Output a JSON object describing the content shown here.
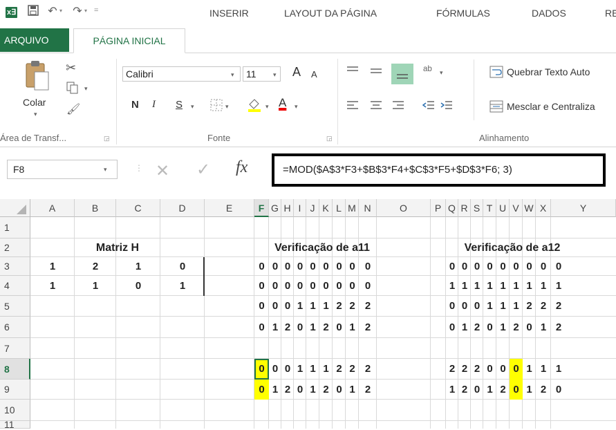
{
  "quick_access": {
    "undo_arrow": "↶",
    "redo_arrow": "↷"
  },
  "tabs": [
    "ARQUIVO",
    "PÁGINA INICIAL",
    "INSERIR",
    "LAYOUT DA PÁGINA",
    "FÓRMULAS",
    "DADOS",
    "RE"
  ],
  "ribbon": {
    "clipboard": {
      "paste": "Colar",
      "group": "Área de Transf..."
    },
    "font": {
      "name": "Calibri",
      "size": "11",
      "grow": "A",
      "shrink": "A",
      "bold": "N",
      "italic": "I",
      "underline": "S",
      "font_color": "A",
      "group": "Fonte"
    },
    "alignment": {
      "wrap": "Quebrar Texto Auto",
      "merge": "Mesclar e Centraliza",
      "group": "Alinhamento"
    }
  },
  "formula_bar": {
    "cell_ref": "F8",
    "fx": "fx",
    "formula": "=MOD($A$3*F3+$B$3*F4+$C$3*F5+$D$3*F6; 3)"
  },
  "columns": [
    "A",
    "B",
    "C",
    "D",
    "E",
    "F",
    "G",
    "H",
    "I",
    "J",
    "K",
    "L",
    "M",
    "N",
    "O",
    "P",
    "Q",
    "R",
    "S",
    "T",
    "U",
    "V",
    "W",
    "X",
    "Y"
  ],
  "rows": [
    "1",
    "2",
    "3",
    "4",
    "5",
    "6",
    "7",
    "8",
    "9",
    "10",
    "11"
  ],
  "selected_cell": {
    "column": "F",
    "row": "8"
  },
  "titles": {
    "matrix": "Matriz H",
    "check_a11": "Verificação de a11",
    "check_a12": "Verificação de a12"
  },
  "matrix_h": [
    [
      "1",
      "2",
      "1",
      "0"
    ],
    [
      "1",
      "1",
      "0",
      "1"
    ]
  ],
  "a11_rows": [
    [
      "0",
      "0",
      "0",
      "0",
      "0",
      "0",
      "0",
      "0",
      "0"
    ],
    [
      "0",
      "0",
      "0",
      "0",
      "0",
      "0",
      "0",
      "0",
      "0"
    ],
    [
      "0",
      "0",
      "0",
      "1",
      "1",
      "1",
      "2",
      "2",
      "2"
    ],
    [
      "0",
      "1",
      "2",
      "0",
      "1",
      "2",
      "0",
      "1",
      "2"
    ],
    [
      "0",
      "0",
      "0",
      "1",
      "1",
      "1",
      "2",
      "2",
      "2"
    ],
    [
      "0",
      "1",
      "2",
      "0",
      "1",
      "2",
      "0",
      "1",
      "2"
    ]
  ],
  "a12_rows": [
    [
      "0",
      "0",
      "0",
      "0",
      "0",
      "0",
      "0",
      "0",
      "0"
    ],
    [
      "1",
      "1",
      "1",
      "1",
      "1",
      "1",
      "1",
      "1",
      "1"
    ],
    [
      "0",
      "0",
      "0",
      "1",
      "1",
      "1",
      "2",
      "2",
      "2"
    ],
    [
      "0",
      "1",
      "2",
      "0",
      "1",
      "2",
      "0",
      "1",
      "2"
    ],
    [
      "2",
      "2",
      "2",
      "0",
      "0",
      "0",
      "1",
      "1",
      "1"
    ],
    [
      "1",
      "2",
      "0",
      "1",
      "2",
      "0",
      "1",
      "2",
      "0"
    ]
  ],
  "colors": {
    "accent": "#217346",
    "highlight": "#ffff00"
  }
}
